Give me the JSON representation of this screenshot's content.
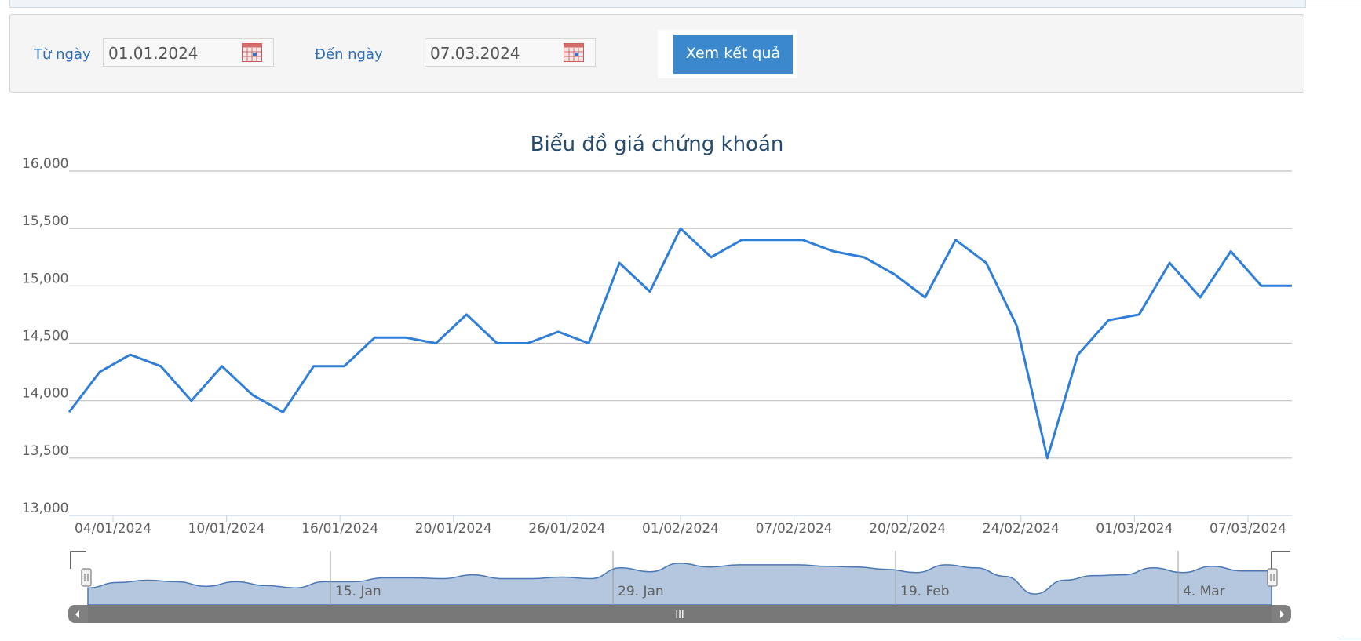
{
  "filter": {
    "from_label": "Từ ngày",
    "from_value": "01.01.2024",
    "to_label": "Đến ngày",
    "to_value": "07.03.2024",
    "submit_label": "Xem kết quả",
    "calendar_icon": "calendar-icon"
  },
  "colors": {
    "line": "#2f7ed8",
    "navigator_fill": "#b5c6df",
    "navigator_line": "#4a78b5",
    "scrollbar": "#808080",
    "button": "#3b88cc",
    "title": "#274b6d"
  },
  "chart_data": {
    "type": "line",
    "title": "Biểu đồ giá chứng khoán",
    "ylim": [
      13000,
      16000
    ],
    "y_ticks": [
      "13,000",
      "13,500",
      "14,000",
      "14,500",
      "15,000",
      "15,500",
      "16,000"
    ],
    "x_tick_labels": [
      "04/01/2024",
      "10/01/2024",
      "16/01/2024",
      "20/01/2024",
      "26/01/2024",
      "01/02/2024",
      "07/02/2024",
      "20/02/2024",
      "24/02/2024",
      "01/03/2024",
      "07/03/2024"
    ],
    "grid": true,
    "series": [
      {
        "values": [
          13900,
          14250,
          14400,
          14300,
          14000,
          14300,
          14050,
          13900,
          14300,
          14300,
          14550,
          14550,
          14500,
          14750,
          14500,
          14500,
          14600,
          14500,
          15200,
          14950,
          15500,
          15250,
          15400,
          15400,
          15400,
          15300,
          15250,
          15100,
          14900,
          15400,
          15200,
          14650,
          13500,
          14400,
          14700,
          14750,
          15200,
          14900,
          15300,
          15000,
          15000
        ]
      }
    ],
    "navigator": {
      "labels": [
        "15. Jan",
        "29. Jan",
        "19. Feb",
        "4. Mar"
      ],
      "scrollbar_grip": "III"
    }
  }
}
